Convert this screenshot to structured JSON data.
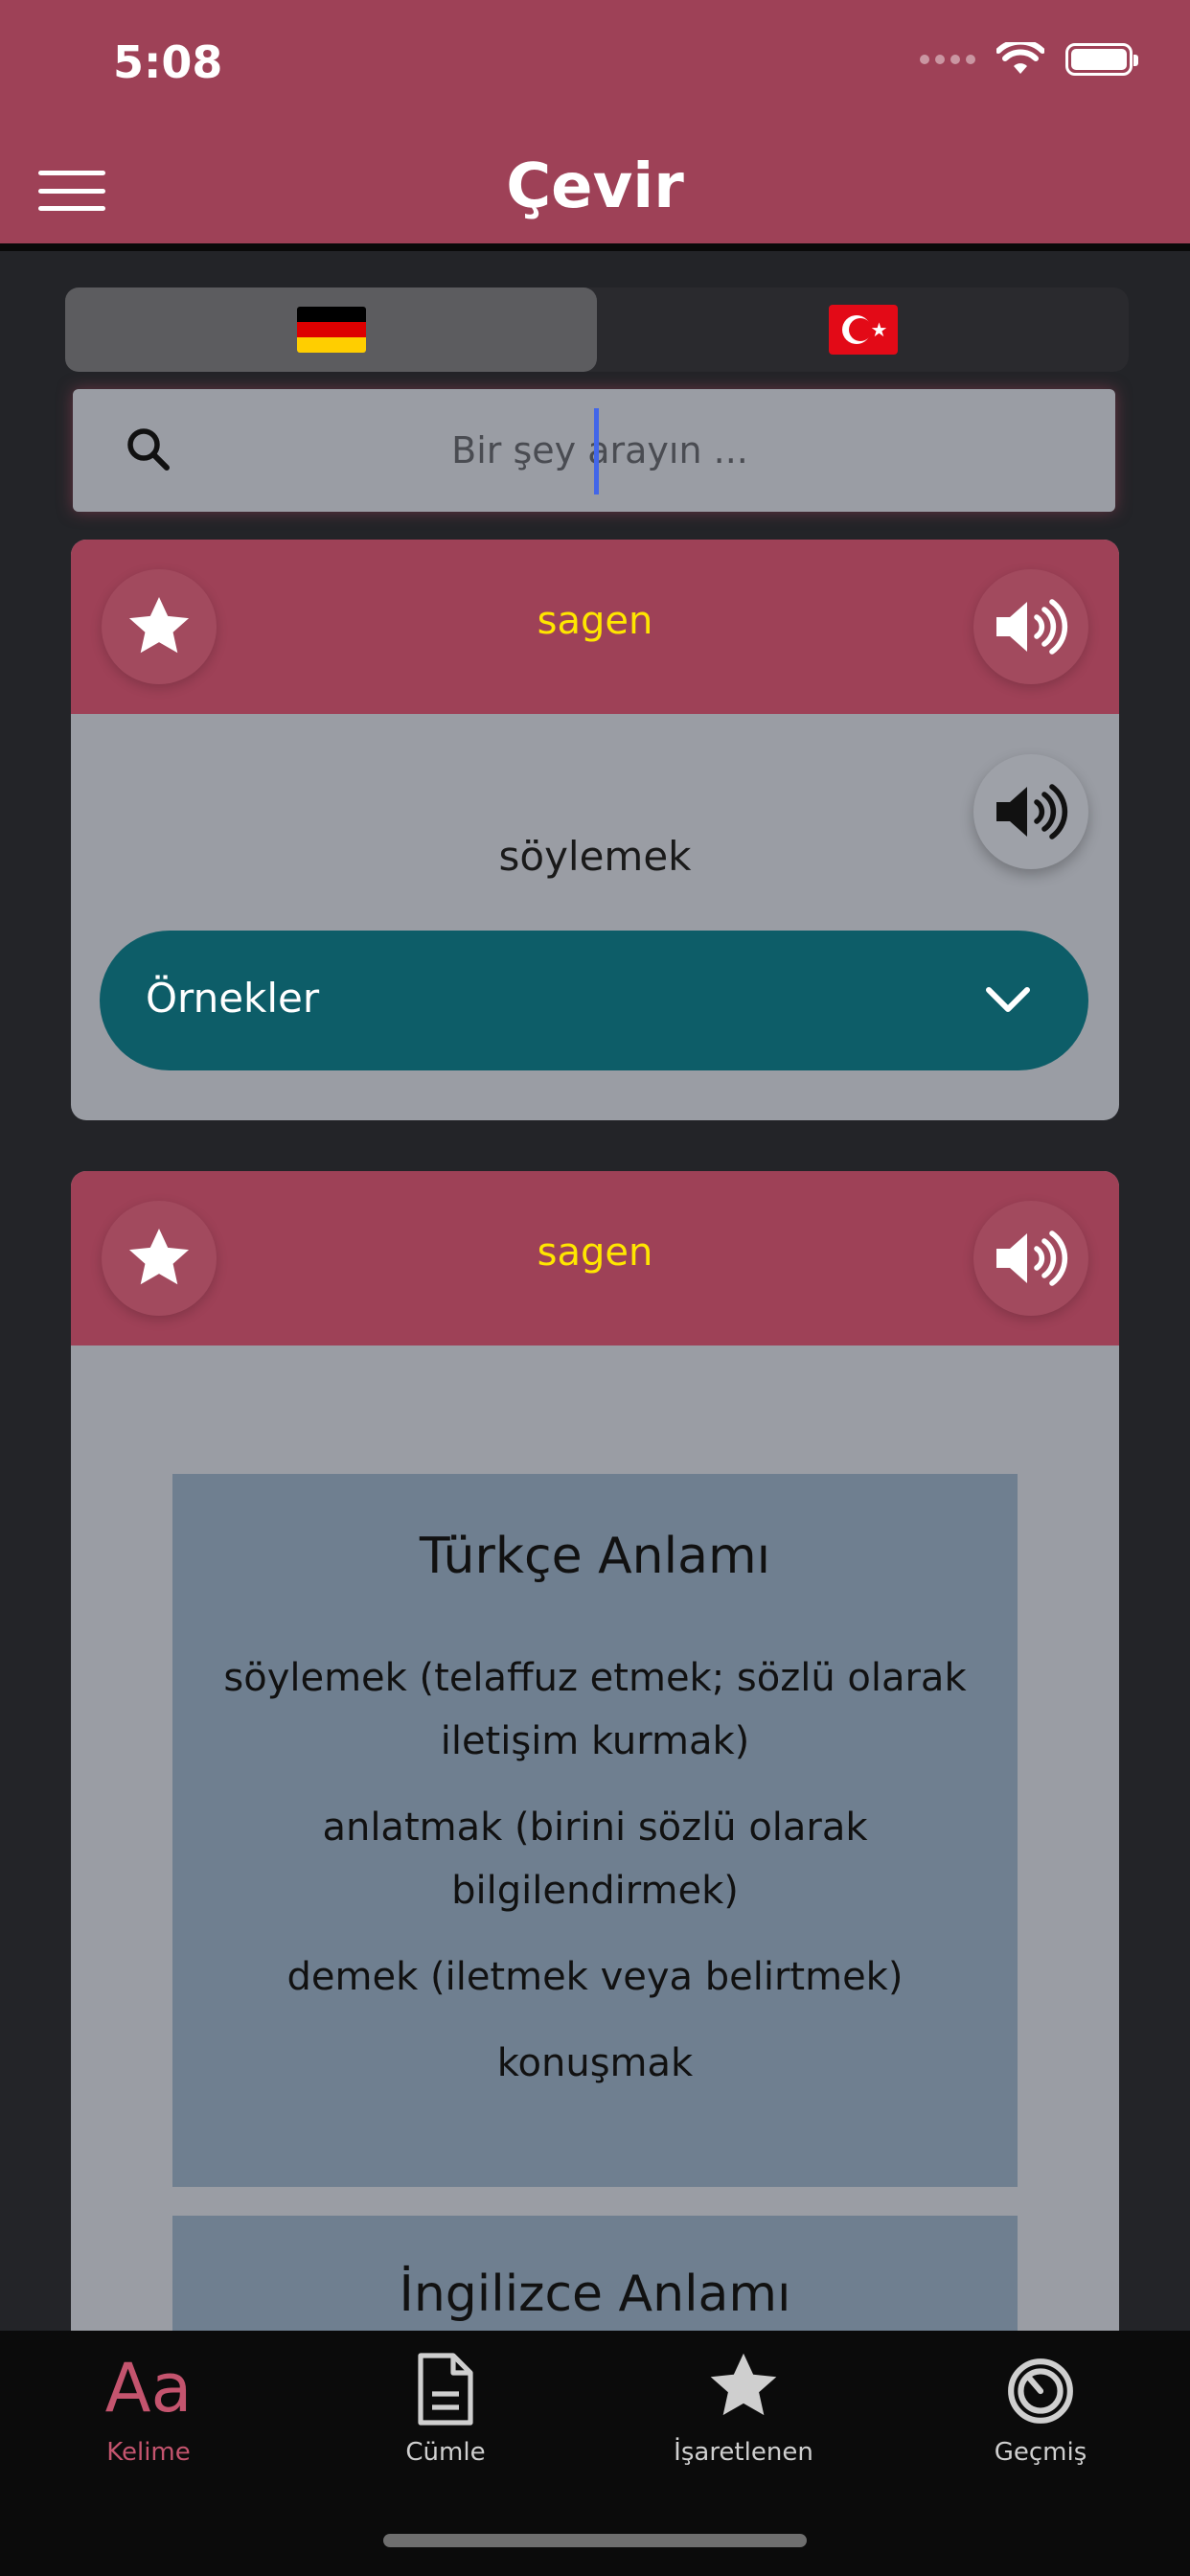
{
  "status": {
    "time": "5:08"
  },
  "header": {
    "title": "Çevir"
  },
  "languages": {
    "source": {
      "flag": "germany-flag-icon",
      "selected": true
    },
    "target": {
      "flag": "turkey-flag-icon",
      "selected": false
    }
  },
  "search": {
    "placeholder": "Bir şey arayın ...",
    "value": ""
  },
  "card1": {
    "word": "sagen",
    "translation": "söylemek",
    "examples_label": "Örnekler"
  },
  "card2": {
    "word": "sagen",
    "turkish_title": "Türkçe Anlamı",
    "turkish_meanings": [
      "söylemek (telaffuz etmek; sözlü olarak iletişim kurmak)",
      "anlatmak (birini sözlü olarak bilgilendirmek)",
      "demek (iletmek veya belirtmek)",
      "konuşmak"
    ],
    "english_title": "İngilizce Anlamı"
  },
  "tabs": [
    {
      "label": "Kelime",
      "icon": "text-aa-icon",
      "active": true
    },
    {
      "label": "Cümle",
      "icon": "document-icon",
      "active": false
    },
    {
      "label": "İşaretlenen",
      "icon": "star-icon",
      "active": false
    },
    {
      "label": "Geçmiş",
      "icon": "history-icon",
      "active": false
    }
  ],
  "colors": {
    "header": "#9e4157",
    "accent_word": "#ffe600",
    "examples": "#0d5d68",
    "active_tab": "#c4546e"
  }
}
